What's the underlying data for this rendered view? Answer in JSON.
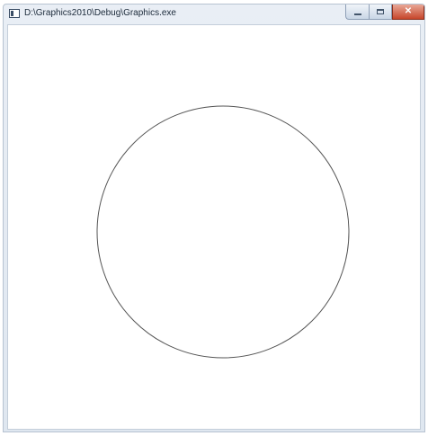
{
  "window": {
    "title": "D:\\Graphics2010\\Debug\\Graphics.exe",
    "icon": "console-app-icon",
    "caption_buttons": {
      "minimize_icon": "minimize-icon",
      "maximize_icon": "maximize-icon",
      "close_icon": "close-icon",
      "close_glyph": "✕"
    }
  },
  "canvas": {
    "background": "#ffffff",
    "shape": "circle",
    "stroke_color": "#555555"
  }
}
